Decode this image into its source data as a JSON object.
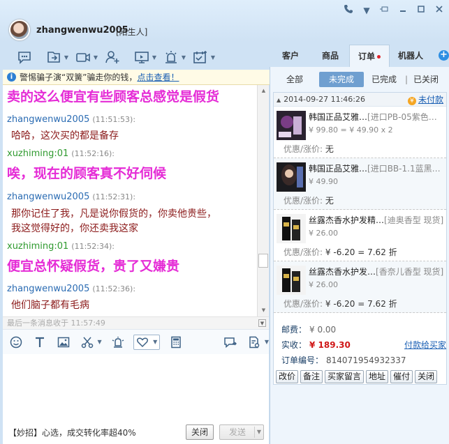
{
  "header": {
    "username": "zhangwenwu2005",
    "stranger_tag": "[陌生人]"
  },
  "right_tabs": {
    "customer": "客户",
    "product": "商品",
    "order": "订单",
    "robot": "机器人",
    "add": "+"
  },
  "notice": {
    "text": "警惕骗子演“双簧”骗走你的钱，",
    "link": "点击查看！"
  },
  "chat": {
    "messages": [
      {
        "text": "卖的这么便宜有些顾客总感觉是假货"
      },
      {
        "sender": "zhangwenwu2005",
        "time": "(11:51:53):",
        "text": "哈哈，这次买的都是备存"
      },
      {
        "sender": "xuzhiming:01",
        "time": "(11:52:16):",
        "text": "唉，现在的顾客真不好伺候"
      },
      {
        "sender": "zhangwenwu2005",
        "time": "(11:52:31):",
        "line1": "那你记住了我，凡是说你假货的，你卖他贵些，",
        "line2": "我这觉得好的，你还卖我这家"
      },
      {
        "sender": "xuzhiming:01",
        "time": "(11:52:34):",
        "text": "便宜总怀疑假货，贵了又嫌贵"
      },
      {
        "sender": "zhangwenwu2005",
        "time": "(11:52:36):",
        "text": "他们脑子都有毛病"
      }
    ],
    "last_received": "最后一条消息收于 11:57:49"
  },
  "bottom": {
    "tip": "【妙招】心选，成交转化率超40%",
    "close": "关闭",
    "send": "发送"
  },
  "order_filters": {
    "all": "全部",
    "incomplete": "未完成",
    "completed": "已完成",
    "separator": "|",
    "closed": "已关闭"
  },
  "order": {
    "time": "2014-09-27 11:46:26",
    "status": "未付款",
    "items": [
      {
        "name": "韩国正品艾雅…",
        "spec": "[进口PB-05紫色…",
        "price": "¥ 99.80 = ¥ 49.90 x 2",
        "disc_label": "优惠/涨价:",
        "disc_value": "无"
      },
      {
        "name": "韩国正品艾雅…",
        "spec": "[进口BB-1.1蓝黑…",
        "price": "¥ 49.90",
        "disc_label": "优惠/涨价:",
        "disc_value": "无"
      },
      {
        "name": "丝露杰香水护发精…",
        "spec": "[迪奥香型 现货]",
        "price": "¥ 26.00",
        "disc_label": "优惠/涨价:",
        "disc_value": "¥ -6.20 = 7.62 折"
      },
      {
        "name": "丝露杰香水护发…",
        "spec": "[香奈儿香型 现货]",
        "price": "¥ 26.00",
        "disc_label": "优惠/涨价:",
        "disc_value": "¥ -6.20 = 7.62 折"
      }
    ],
    "postage_label": "邮费：",
    "postage": "¥ 0.00",
    "paid_label": "实收：",
    "paid": "¥ 189.30",
    "pay_friend": "付款给买家",
    "number_label": "订单编号：",
    "number": "814071954932337"
  },
  "actions": [
    "改价",
    "备注",
    "买家留言",
    "地址",
    "催付",
    "关闭"
  ]
}
